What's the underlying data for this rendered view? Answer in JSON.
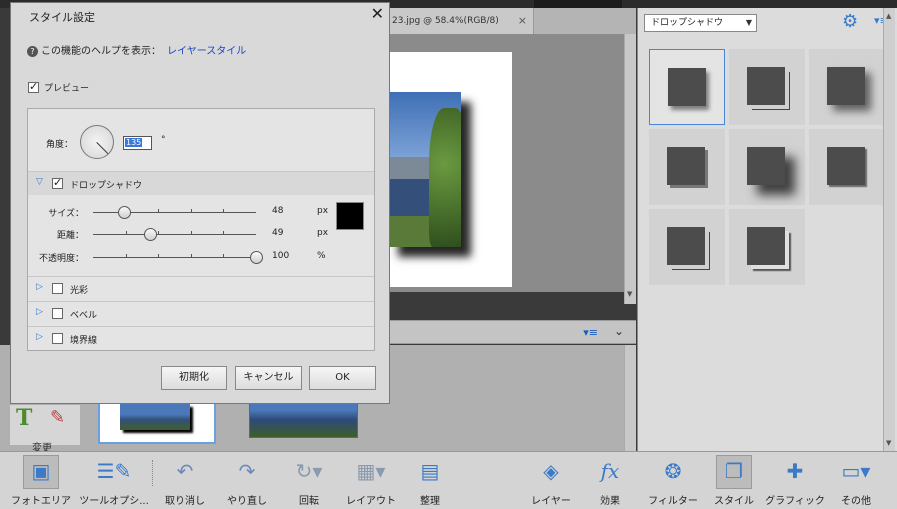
{
  "document": {
    "tab_title": "23.jpg @ 58.4%(RGB/8)",
    "close_glyph": "×"
  },
  "dialog": {
    "title": "スタイル設定",
    "close_glyph": "✕",
    "help_text": "この機能のヘルプを表示：",
    "help_link": "レイヤースタイル",
    "preview_label": "プレビュー",
    "preview_checked": true,
    "angle_label": "角度：",
    "angle_value": "135",
    "angle_unit": "°",
    "drop_shadow": {
      "label": "ドロップシャドウ",
      "checked": true,
      "size_label": "サイズ：",
      "size_value": "48",
      "size_fraction": 0.19,
      "distance_label": "距離：",
      "distance_value": "49",
      "distance_fraction": 0.35,
      "opacity_label": "不透明度：",
      "opacity_value": "100",
      "opacity_fraction": 1.0,
      "px_unit": "px",
      "pct_unit": "%",
      "shadow_color": "#000000"
    },
    "sections": [
      {
        "label": "光彩",
        "checked": false
      },
      {
        "label": "ベベル",
        "checked": false
      },
      {
        "label": "境界線",
        "checked": false
      }
    ],
    "buttons": {
      "reset": "初期化",
      "cancel": "キャンセル",
      "ok": "OK"
    }
  },
  "right_panel": {
    "dropdown_value": "ドロップシャドウ",
    "gear_icon": "gear-icon",
    "menu_icon": "panel-menu-icon"
  },
  "left_tool": {
    "label": "変更"
  },
  "toolbar": {
    "items": [
      {
        "label": "フォトエリア",
        "icon": "photo-bin-icon",
        "active": true
      },
      {
        "label": "ツールオプシ...",
        "icon": "tool-options-icon",
        "active": false
      },
      {
        "label": "取り消し",
        "icon": "undo-icon",
        "active": false
      },
      {
        "label": "やり直し",
        "icon": "redo-icon",
        "active": false
      },
      {
        "label": "回転",
        "icon": "rotate-icon",
        "active": false
      },
      {
        "label": "レイアウト",
        "icon": "layout-icon",
        "active": false
      },
      {
        "label": "整理",
        "icon": "organize-icon",
        "active": false
      },
      {
        "label": "レイヤー",
        "icon": "layers-icon",
        "active": false
      },
      {
        "label": "効果",
        "icon": "fx-icon",
        "active": false
      },
      {
        "label": "フィルター",
        "icon": "filter-icon",
        "active": false
      },
      {
        "label": "スタイル",
        "icon": "styles-icon",
        "active": true
      },
      {
        "label": "グラフィック",
        "icon": "graphics-icon",
        "active": false
      },
      {
        "label": "その他",
        "icon": "more-icon",
        "active": false
      }
    ]
  },
  "colors": {
    "accent": "#3a7ac8",
    "link": "#1a44c8",
    "selection": "#4a86d8"
  }
}
